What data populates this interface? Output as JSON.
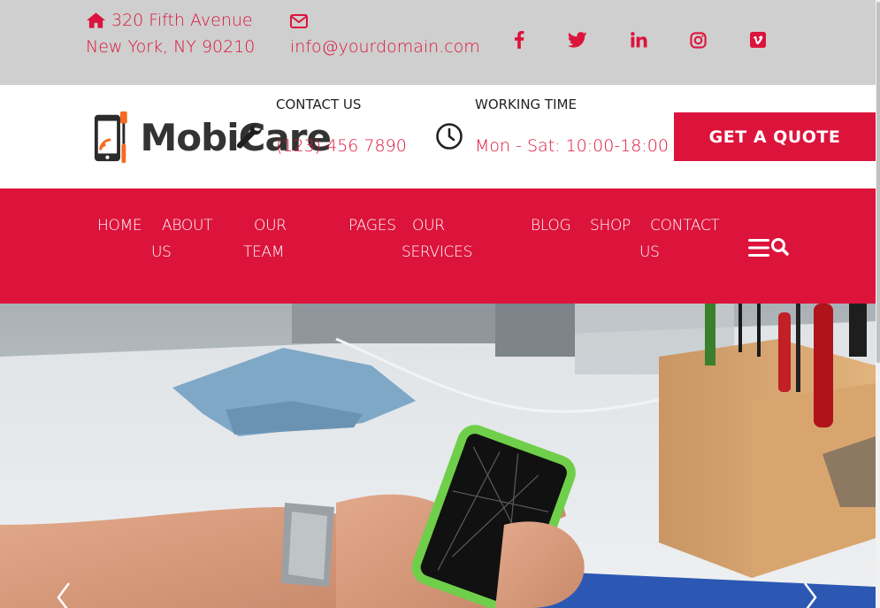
{
  "topbar": {
    "address_line1": "320 Fifth Avenue",
    "address_line2": "New York, NY 90210",
    "email": "info@yourdomain.com",
    "social": [
      {
        "icon": "facebook-icon"
      },
      {
        "icon": "twitter-icon"
      },
      {
        "icon": "linkedin-icon"
      },
      {
        "icon": "instagram-icon"
      },
      {
        "icon": "vimeo-icon"
      }
    ]
  },
  "header": {
    "logo_text": "MobiCare",
    "contact_label": "CONTACT US",
    "contact_phone": "(123) 456 7890",
    "working_label": "WORKING TIME",
    "working_hours": "Mon - Sat: 10:00-18:00",
    "quote_button": "GET A QUOTE"
  },
  "nav": {
    "items": [
      {
        "line1": "HOME",
        "line2": ""
      },
      {
        "line1": "ABOUT",
        "line2": "US"
      },
      {
        "line1": "OUR",
        "line2": "TEAM"
      },
      {
        "line1": "PAGES",
        "line2": ""
      },
      {
        "line1": "OUR",
        "line2": "SERVICES"
      },
      {
        "line1": "BLOG",
        "line2": ""
      },
      {
        "line1": "SHOP",
        "line2": ""
      },
      {
        "line1": "CONTACT",
        "line2": "US"
      }
    ]
  },
  "colors": {
    "accent": "#dc143c",
    "topbar_bg": "#cfcfcf"
  }
}
